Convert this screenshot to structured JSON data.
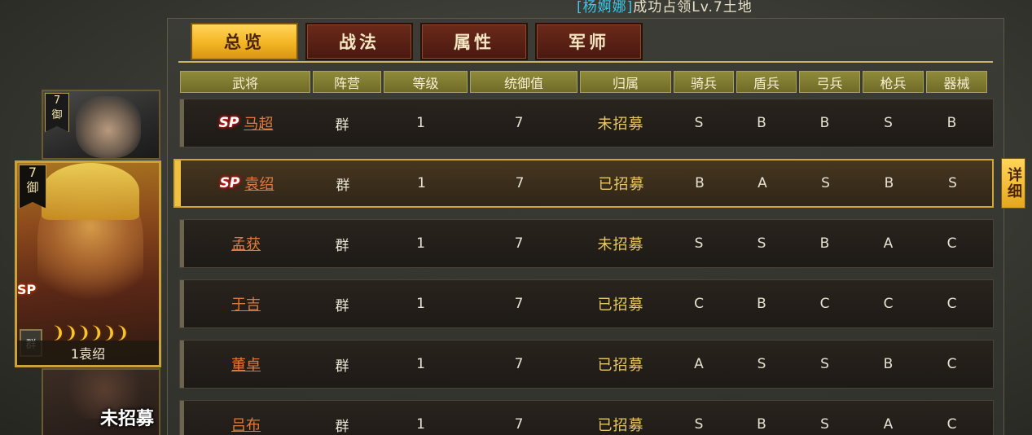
{
  "notice": {
    "player": "[杨婀娜]",
    "message": "成功占领Lv.7土地"
  },
  "tabs": [
    "总览",
    "战法",
    "属性",
    "军师"
  ],
  "columns": [
    "武将",
    "阵营",
    "等级",
    "统御值",
    "归属",
    "骑兵",
    "盾兵",
    "弓兵",
    "枪兵",
    "器械"
  ],
  "rows": [
    {
      "sp": "SP",
      "name": "马超",
      "camp": "群",
      "level": "1",
      "cost": "7",
      "status": "未招募",
      "cavalry": "S",
      "shield": "B",
      "archer": "B",
      "spear": "S",
      "siege": "B"
    },
    {
      "sp": "SP",
      "name": "袁绍",
      "camp": "群",
      "level": "1",
      "cost": "7",
      "status": "已招募",
      "cavalry": "B",
      "shield": "A",
      "archer": "S",
      "spear": "B",
      "siege": "S"
    },
    {
      "sp": "",
      "name": "孟获",
      "camp": "群",
      "level": "1",
      "cost": "7",
      "status": "未招募",
      "cavalry": "S",
      "shield": "S",
      "archer": "B",
      "spear": "A",
      "siege": "C"
    },
    {
      "sp": "",
      "name": "于吉",
      "camp": "群",
      "level": "1",
      "cost": "7",
      "status": "已招募",
      "cavalry": "C",
      "shield": "B",
      "archer": "C",
      "spear": "C",
      "siege": "C"
    },
    {
      "sp": "",
      "name": "董卓",
      "camp": "群",
      "level": "1",
      "cost": "7",
      "status": "已招募",
      "cavalry": "A",
      "shield": "S",
      "archer": "S",
      "spear": "B",
      "siege": "C"
    },
    {
      "sp": "",
      "name": "吕布",
      "camp": "群",
      "level": "1",
      "cost": "7",
      "status": "已招募",
      "cavalry": "S",
      "shield": "B",
      "archer": "S",
      "spear": "A",
      "siege": "C"
    }
  ],
  "detail_button": "详细",
  "side": {
    "top_card": {
      "rank_num": "7",
      "rank_word": "御"
    },
    "main_card": {
      "rank_num": "7",
      "rank_word": "御",
      "sp": "SP",
      "faction": "群",
      "stars": "❩❩❩❩❩❩",
      "name": "1袁绍"
    },
    "bottom_card": {
      "status": "未招募"
    }
  }
}
